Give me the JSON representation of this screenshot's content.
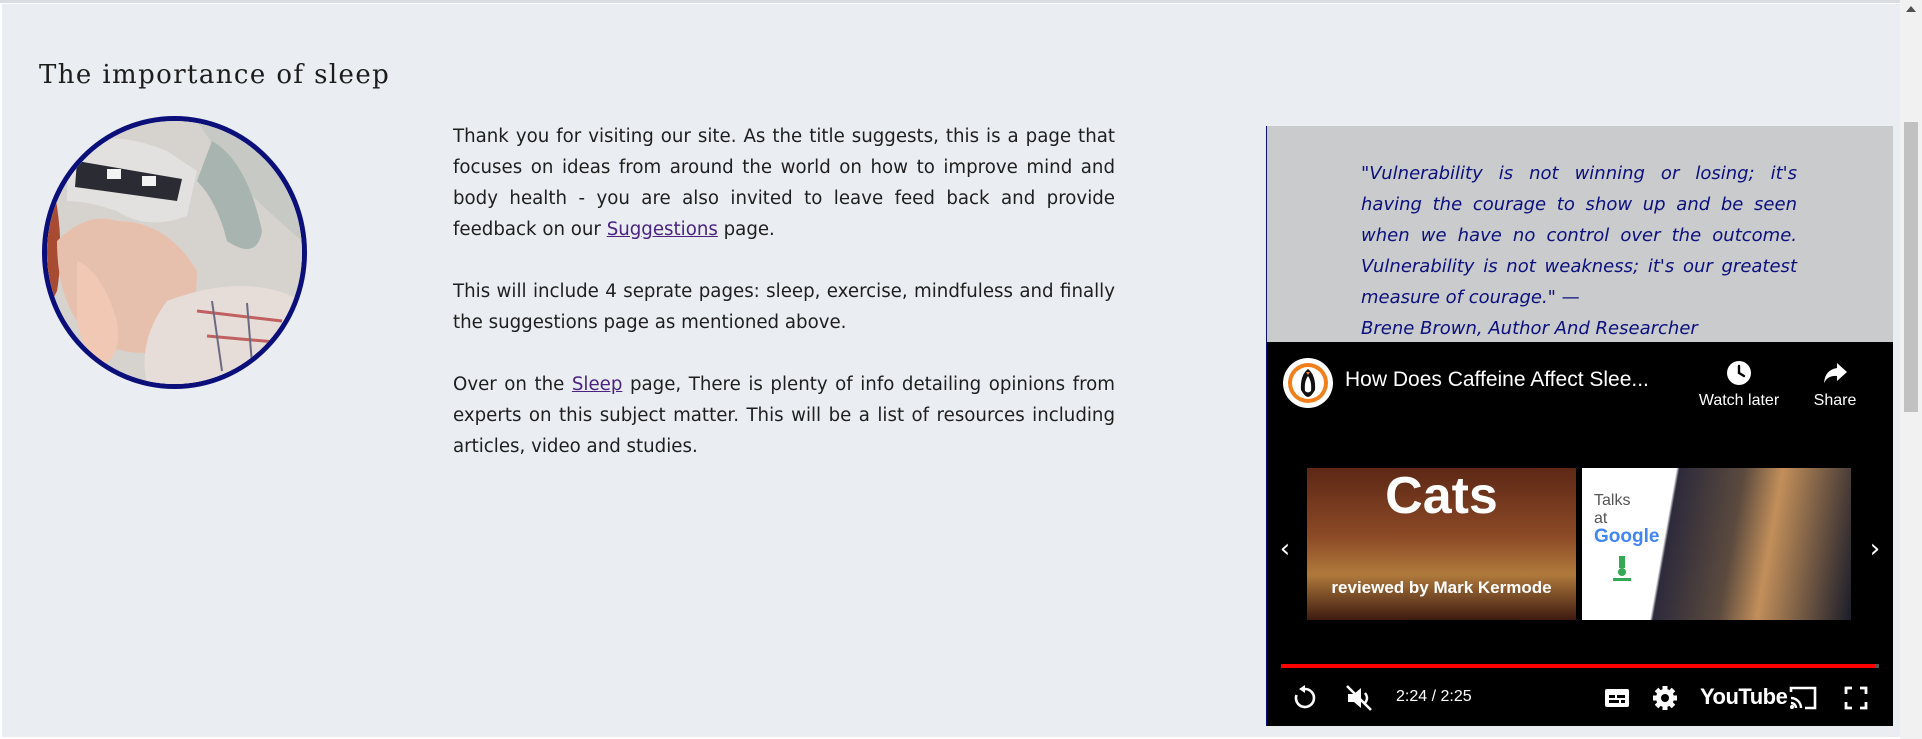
{
  "page": {
    "title": "The importance of sleep"
  },
  "avatar": {
    "alt": "woman-yawning-in-bed-with-sleep-mask"
  },
  "intro": {
    "p1_before_link": "Thank you for visiting our site. As the title suggests, this is a page that focuses on ideas from around the world on how to improve mind and body health - you are also invited to leave feed back and provide feedback on our ",
    "p1_link": "Suggestions",
    "p1_after_link": " page.",
    "p2": "This will include 4 seprate pages: sleep, exercise, mindfuless and finally the suggestions page as mentioned above.",
    "p3_before_link": "Over on the ",
    "p3_link": "Sleep",
    "p3_after_link": " page, There is plenty of info detailing opinions from experts on this subject matter. This will be a list of resources including articles, video and studies."
  },
  "quote": {
    "text": "\"Vulnerability is not winning or losing; it's having the courage to show up and be seen when we have no control over the outcome. Vulnerability is not weakness; it's our greatest measure of courage.\" —",
    "author": "Brene Brown, Author And Researcher"
  },
  "video": {
    "title": "How Does Caffeine Affect Slee...",
    "watch_later_label": "Watch later",
    "share_label": "Share",
    "time": "2:24 / 2:25",
    "progress": 0.993,
    "brand": "YouTube",
    "thumbnails": [
      {
        "title": "Cats",
        "subtitle": "reviewed by Mark Kermode"
      },
      {
        "line1": "Talks",
        "line2": "at",
        "line3": "Google"
      }
    ],
    "icons": {
      "channel": "penguin-logo-icon",
      "watch_later": "clock-icon",
      "share": "share-arrow-icon",
      "prev": "chevron-left-icon",
      "next": "chevron-right-icon",
      "replay": "replay-icon",
      "mute": "muted-speaker-icon",
      "captions": "captions-icon",
      "settings": "gear-icon",
      "cast": "cast-icon",
      "fullscreen": "fullscreen-icon"
    }
  },
  "colors": {
    "page_background": "#eaedf1",
    "avatar_border": "#0b0f7a",
    "link": "#4a2380",
    "quote_text": "#0b107d",
    "quote_background": "#c9cbcc",
    "progress_red": "#ff0000"
  }
}
